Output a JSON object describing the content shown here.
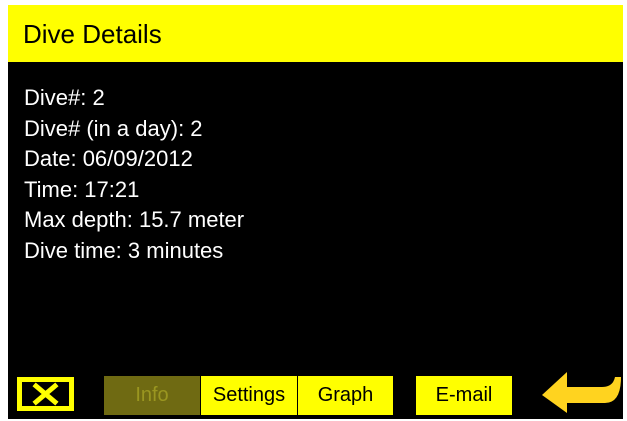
{
  "header": {
    "title": "Dive Details"
  },
  "details": [
    "Dive#: 2",
    "Dive# (in a day): 2",
    "Date: 06/09/2012",
    "Time: 17:21",
    "Max depth: 15.7 meter",
    "Dive time: 3 minutes"
  ],
  "toolbar": {
    "close_icon": "close-x-icon",
    "tabs": [
      {
        "label": "Info",
        "state": "disabled"
      },
      {
        "label": "Settings",
        "state": "enabled"
      },
      {
        "label": "Graph",
        "state": "enabled"
      },
      {
        "label": "E-mail",
        "state": "enabled"
      }
    ],
    "back_icon": "return-arrow-icon"
  },
  "colors": {
    "accent": "#ffff00",
    "background": "#000000",
    "text": "#ffffff",
    "disabled_tab": "#6f6a12",
    "disabled_text": "#9a9620",
    "back_arrow": "#ffd31f"
  }
}
